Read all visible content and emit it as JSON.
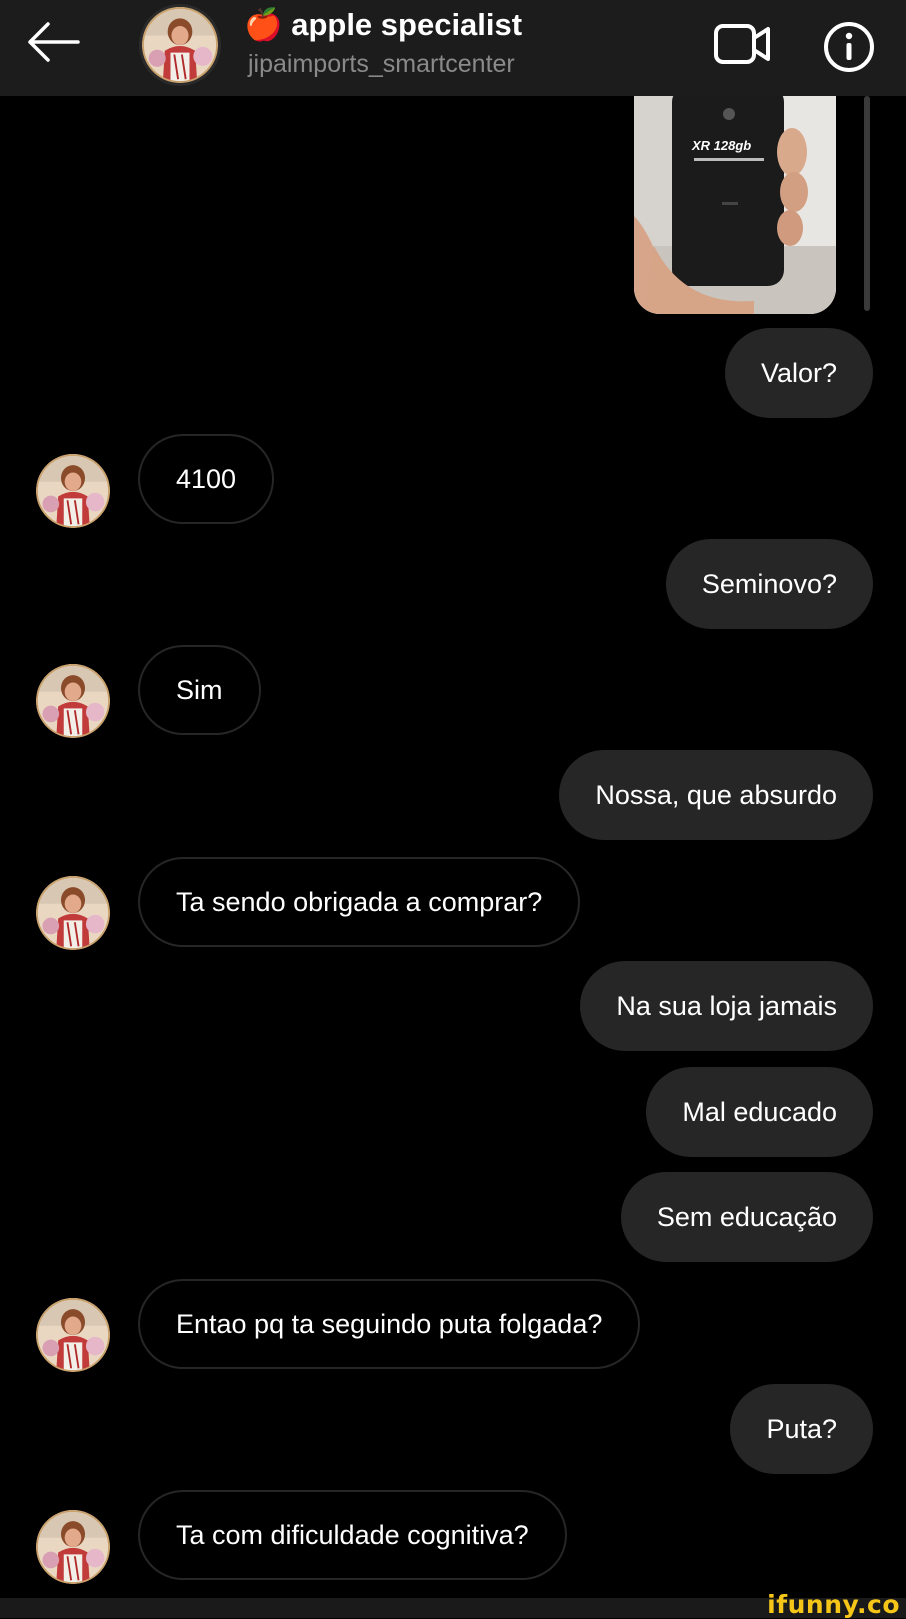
{
  "header": {
    "title": "🍎 apple specialist",
    "subtitle": "jipaimports_smartcenter",
    "back_icon": "arrow-left-icon",
    "video_icon": "video-camera-icon",
    "info_icon": "info-circle-icon"
  },
  "photo": {
    "model_text": "XR 128gb"
  },
  "messages": [
    {
      "sender": "me",
      "text": "Valor?"
    },
    {
      "sender": "them",
      "text": "4100"
    },
    {
      "sender": "me",
      "text": "Seminovo?"
    },
    {
      "sender": "them",
      "text": "Sim"
    },
    {
      "sender": "me",
      "text": "Nossa, que absurdo"
    },
    {
      "sender": "them",
      "text": "Ta sendo obrigada a comprar?"
    },
    {
      "sender": "me",
      "text": "Na sua loja jamais"
    },
    {
      "sender": "me",
      "text": "Mal educado"
    },
    {
      "sender": "me",
      "text": "Sem educação"
    },
    {
      "sender": "them",
      "text": "Entao pq ta seguindo puta folgada?"
    },
    {
      "sender": "me",
      "text": "Puta?"
    },
    {
      "sender": "them",
      "text": "Ta com dificuldade cognitiva?"
    }
  ],
  "watermark": "ifunny.co",
  "colors": {
    "background": "#000000",
    "header": "#1c1c1c",
    "outgoing_bubble": "#262626",
    "incoming_border": "#262626",
    "watermark": "#f5c518"
  }
}
